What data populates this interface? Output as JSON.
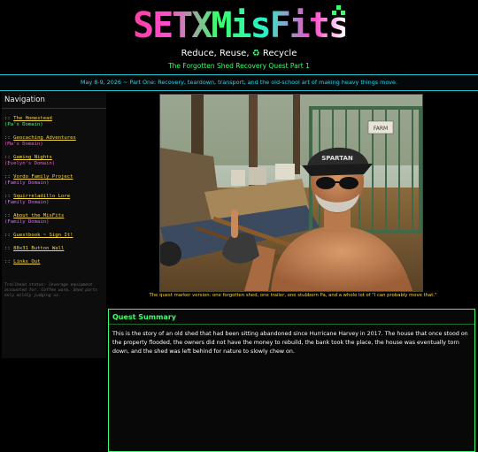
{
  "header": {
    "logo_text": "SETXMisFits",
    "tagline_before": "Reduce, Reuse,",
    "recycle_icon": "♻",
    "tagline_after": "Recycle",
    "subtitle": "The Forgotten Shed Recovery Quest Part 1"
  },
  "banner": "May 8-9, 2026 ~ Part One: Recovery, teardown, transport, and the old-school art of making heavy things move.",
  "sidebar": {
    "title": "Navigation",
    "items": [
      {
        "prefix": "::",
        "label": "The Homestead",
        "sub": "(Pa's Domain)",
        "sub_color": "#39ff6a"
      },
      {
        "prefix": "::",
        "label": "Geocaching Adventures",
        "sub": "(Ma's Domain)",
        "sub_color": "#ff4fd0"
      },
      {
        "prefix": "::",
        "label": "Gaming Nights",
        "sub": "(Evelyn's Domain)",
        "sub_color": "#ff4fd0"
      },
      {
        "prefix": "::",
        "label": "Vordo Family Project",
        "sub": "(Family Domain)",
        "sub_color": "#d36bff"
      },
      {
        "prefix": "::",
        "label": "Squirreladillo Lore",
        "sub": "(Family Domain)",
        "sub_color": "#d36bff"
      },
      {
        "prefix": "::",
        "label": "About the MisFits",
        "sub": "(Family Domain)",
        "sub_color": "#d36bff"
      },
      {
        "prefix": "::",
        "label": "Guestbook ~ Sign It!",
        "sub": "",
        "sub_color": ""
      },
      {
        "prefix": "::",
        "label": "88x31 Button Wall",
        "sub": "",
        "sub_color": ""
      },
      {
        "prefix": "::",
        "label": "Links Out",
        "sub": "",
        "sub_color": ""
      }
    ],
    "footnote": "Trailhead status: leverage equipment accounted for. Coffee warm. Shed parts only mildly judging us."
  },
  "photo": {
    "hat_text": "SPARTAN",
    "sign_text": "FARM"
  },
  "caption": "The quest marker version: one forgotten shed, one trailer, one stubborn Pa, and a whole lot of \"I can probably move that.\"",
  "summary": {
    "title": "Quest Summary",
    "text": "This is the story of an old shed that had been sitting abandoned since Hurricane Harvey in 2017. The house that once stood on the property flooded, the owners did not have the money to rebuild, the bank took the place, the house was eventually torn down, and the shed was left behind for nature to slowly chew on."
  },
  "colors": {
    "accent_green": "#39ff6a",
    "accent_cyan": "#29d6e8",
    "link_yellow": "#f5d742",
    "magenta": "#ff4fd0"
  }
}
